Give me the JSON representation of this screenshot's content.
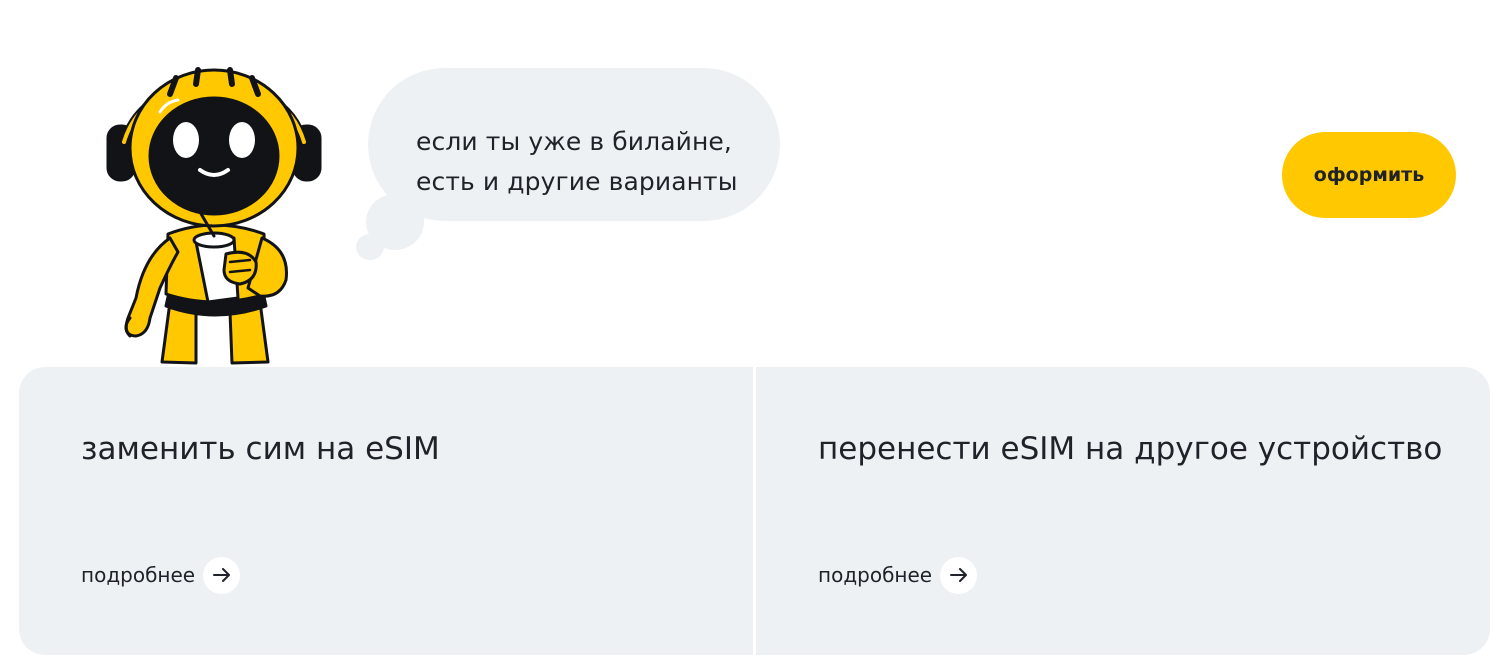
{
  "promo": {
    "bubble_line_1": "если ты уже в билайне,",
    "bubble_line_2": "есть и другие варианты",
    "cta_label": "оформить",
    "mascot_icon": "robot-mascot-with-cup-icon"
  },
  "cards": [
    {
      "title": "заменить сим на eSIM",
      "more_label": "подробнее",
      "arrow_icon": "arrow-right-icon"
    },
    {
      "title": "перенести eSIM на другое устройство",
      "more_label": "подробнее",
      "arrow_icon": "arrow-right-icon"
    }
  ],
  "colors": {
    "accent": "#ffc800",
    "card_bg": "#eef1f4",
    "text": "#1f2229",
    "mascot_dark": "#121316"
  }
}
